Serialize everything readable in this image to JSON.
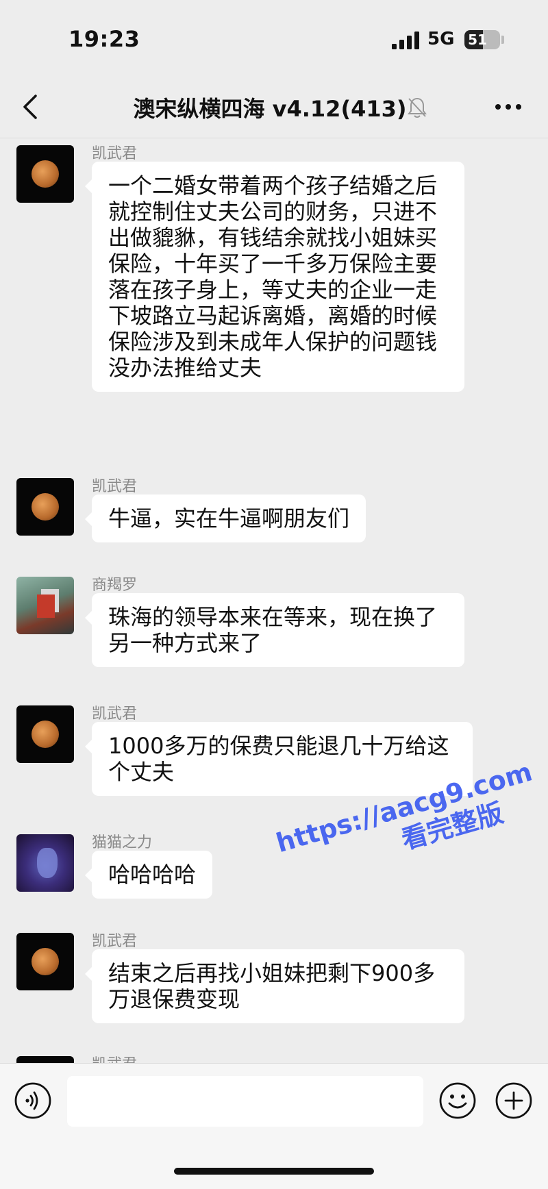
{
  "status_bar": {
    "time": "19:23",
    "network": "5G",
    "battery_level": "51",
    "battery_fraction": 0.51
  },
  "nav": {
    "title": "澳宋纵横四海 v4.12(413)",
    "back_icon": "chevron-left-icon",
    "mute_icon": "bell-off-icon",
    "more_icon": "more-dots-icon"
  },
  "messages": [
    {
      "sender": "凯武君",
      "avatar": "moon",
      "text": "一个二婚女带着两个孩子结婚之后就控制住丈夫公司的财务，只进不出做貔貅，有钱结余就找小姐妹买保险，十年买了一千多万保险主要落在孩子身上，等丈夫的企业一走下坡路立马起诉离婚，离婚的时候保险涉及到未成年人保护的问题钱没办法推给丈夫"
    },
    {
      "sender": "凯武君",
      "avatar": "moon",
      "text": "牛逼，实在牛逼啊朋友们"
    },
    {
      "sender": "商羯罗",
      "avatar": "game",
      "text": "珠海的领导本来在等来，现在换了另一种方式来了"
    },
    {
      "sender": "凯武君",
      "avatar": "moon",
      "text": "1000多万的保费只能退几十万给这个丈夫"
    },
    {
      "sender": "猫猫之力",
      "avatar": "cat",
      "text": "哈哈哈哈"
    },
    {
      "sender": "凯武君",
      "avatar": "moon",
      "text": "结束之后再找小姐妹把剩下900多万退保费变现"
    },
    {
      "sender": "凯武君",
      "avatar": "moon",
      "text": ""
    }
  ],
  "watermark": {
    "url": "https://aacg9.com",
    "subtitle": "看完整版"
  },
  "input_bar": {
    "voice_icon": "voice-icon",
    "input_value": "",
    "emoji_icon": "emoji-icon",
    "plus_icon": "plus-icon"
  }
}
